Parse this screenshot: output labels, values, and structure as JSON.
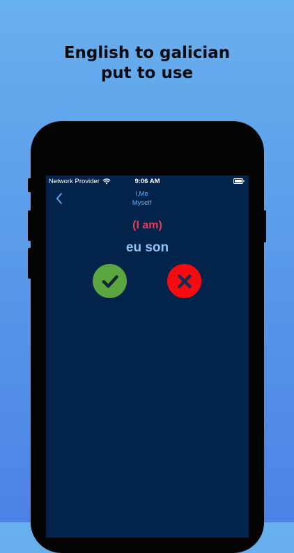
{
  "headline": {
    "line1": "English to galician",
    "line2": "put to use"
  },
  "status_bar": {
    "carrier": "Network Provider",
    "time": "9:06 AM",
    "icons": [
      "wifi-icon",
      "battery-icon"
    ]
  },
  "nav": {
    "back_icon": "chevron-left-icon",
    "title_line1": "I,Me",
    "title_line2": "Myself"
  },
  "card": {
    "english": "(I am)",
    "translation": "eu son"
  },
  "buttons": {
    "correct_icon": "checkmark-icon",
    "wrong_icon": "x-mark-icon"
  },
  "colors": {
    "background_top": "#69b0ee",
    "background_bottom": "#4c82e6",
    "screen": "#03234a",
    "english_text": "#e8395c",
    "translation_text": "#8cc4f5",
    "nav_text": "#5fb0f5",
    "correct": "#5aa53f",
    "wrong": "#f40c10"
  }
}
